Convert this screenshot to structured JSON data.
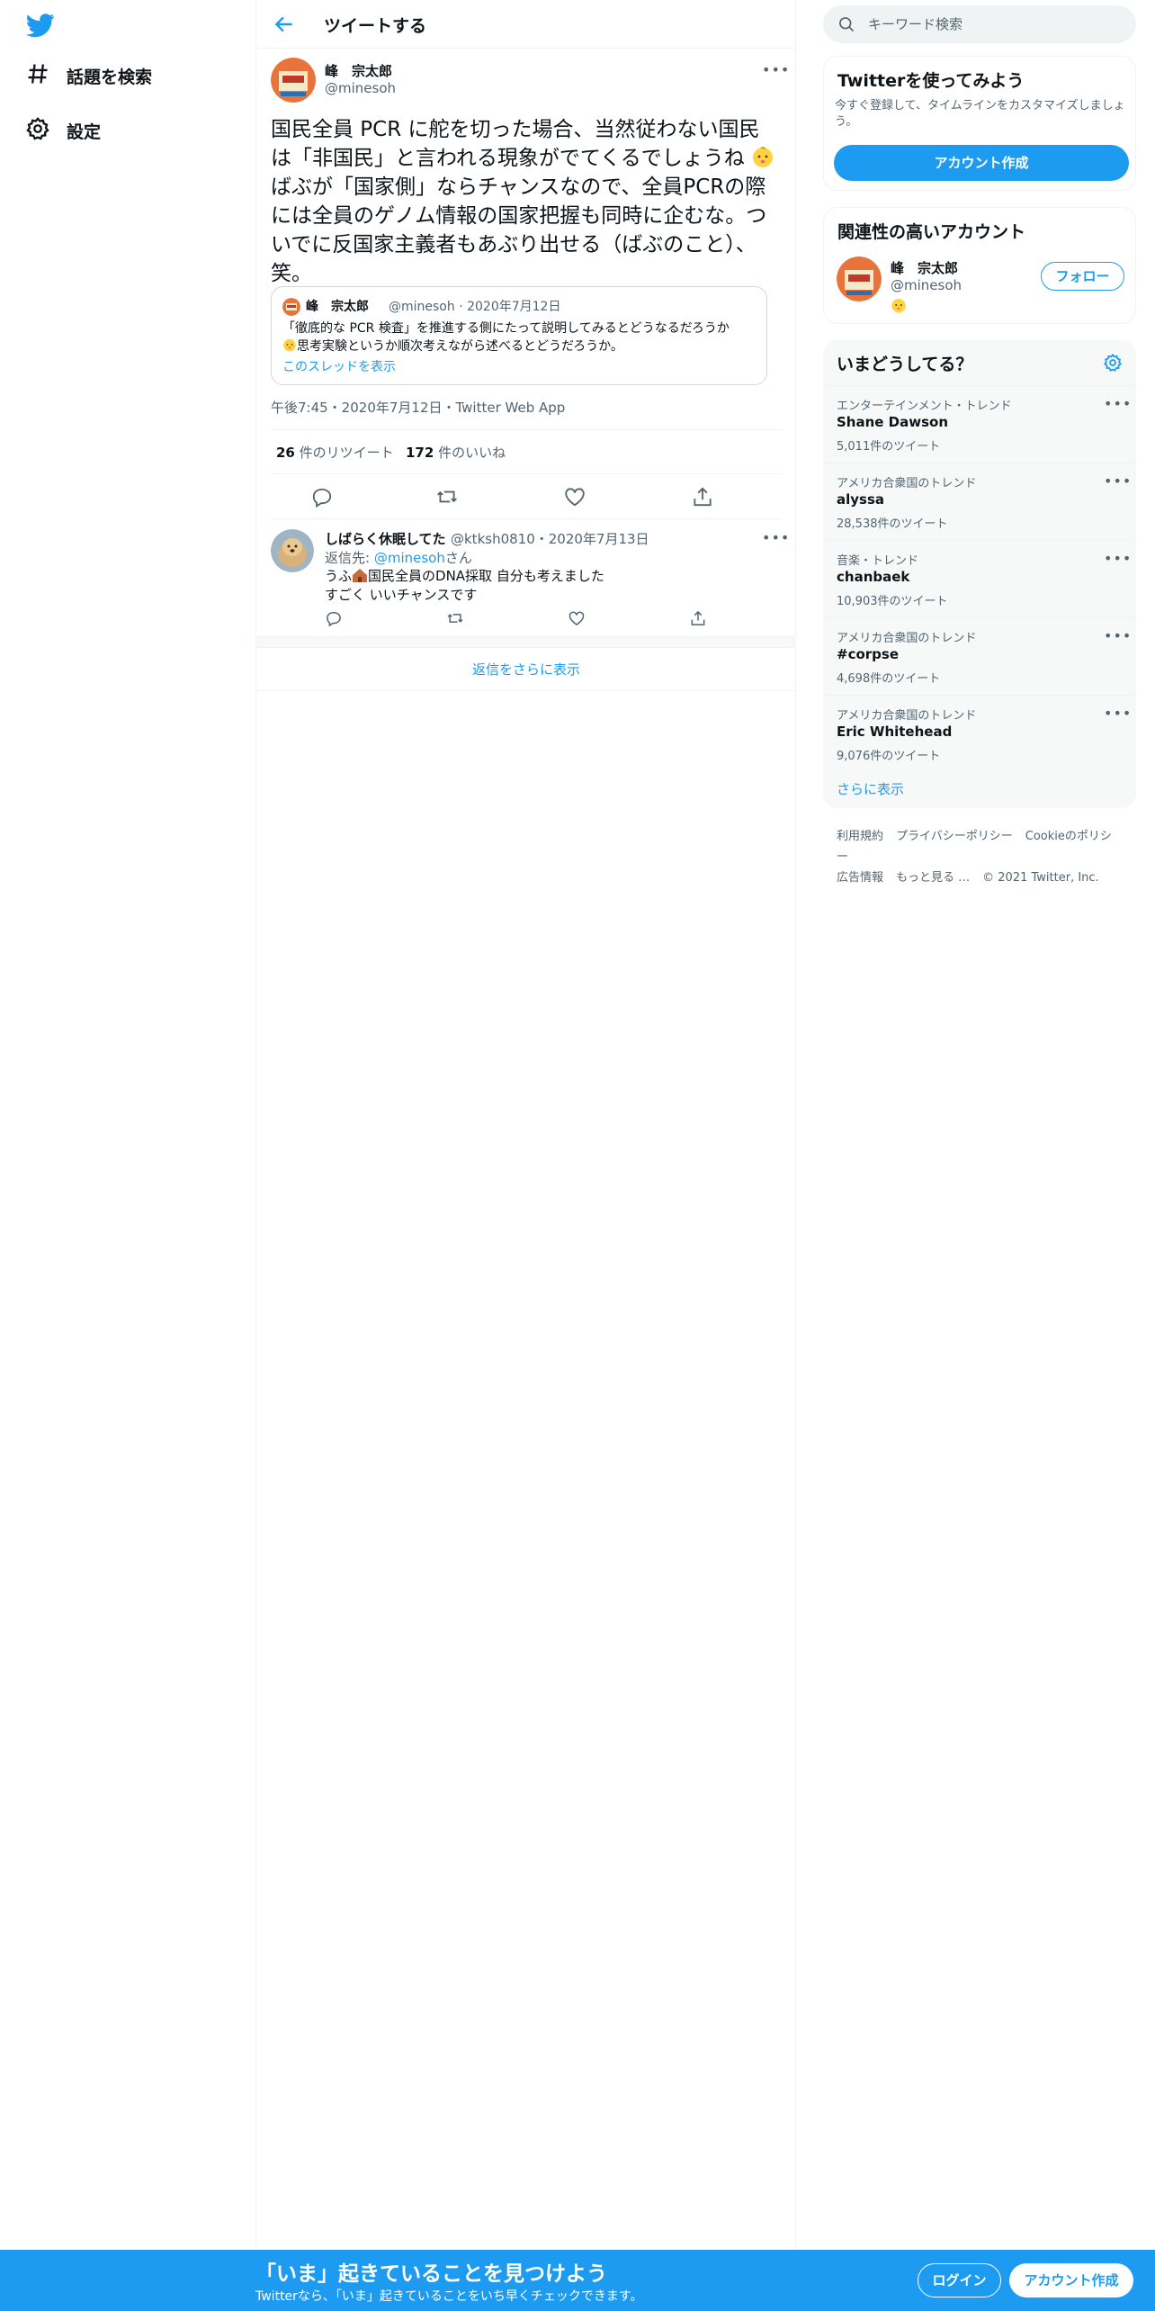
{
  "colors": {
    "accent": "#1d9bf0",
    "text": "#0f1419",
    "secondary": "#536471",
    "border": "#eff3f4"
  },
  "nav": {
    "items": [
      {
        "label": "話題を検索",
        "icon": "hashtag-icon"
      },
      {
        "label": "設定",
        "icon": "gear-icon"
      }
    ]
  },
  "header": {
    "title": "ツイートする"
  },
  "tweet": {
    "author_name": "峰　宗太郎",
    "author_handle": "@minesoh",
    "text_part1": "国民全員 PCR に舵を切った場合、当然従わない国民は「非国民」と言われる現象がでてくるでしょうね",
    "text_part2": "ばぶが「国家側」ならチャンスなので、全員PCRの際には全員のゲノム情報の国家把握も同時に企むな。ついでに反国家主義者もあぶり出せる（ばぶのこと）、笑。",
    "quote": {
      "author_name": "峰　宗太郎",
      "meta": "@minesoh · 2020年7月12日",
      "text_part1": "「徹底的な PCR 検査」を推進する側にたって説明してみるとどうなるだろうか",
      "text_part2": "思考実験というか順次考えながら述べるとどうだろうか。",
      "thread_link": "このスレッドを表示"
    },
    "meta": "午後7:45・2020年7月12日・Twitter Web App",
    "retweets": "26",
    "retweets_label": "件のリツイート",
    "likes": "172",
    "likes_label": "件のいいね"
  },
  "reply": {
    "author_name": "しばらく休眠してた",
    "meta": "@ktksh0810・2020年7月13日",
    "reply_to_prefix": "返信先: ",
    "reply_to_handle": "@minesoh",
    "reply_to_suffix": "さん",
    "text_line1_a": "うふ",
    "text_line1_b": "国民全員のDNA採取 自分も考えました",
    "text_line2": "すごく いいチャンスです"
  },
  "more_replies": "返信をさらに表示",
  "search": {
    "placeholder": "キーワード検索"
  },
  "signup_card": {
    "title": "Twitterを使ってみよう",
    "description": "今すぐ登録して、タイムラインをカスタマイズしましょう。",
    "button": "アカウント作成"
  },
  "related": {
    "title": "関連性の高いアカウント",
    "name": "峰　宗太郎",
    "handle": "@minesoh",
    "follow": "フォロー"
  },
  "trends": {
    "title": "いまどうしてる？",
    "items": [
      {
        "category": "エンターテインメント・トレンド",
        "name": "Shane Dawson",
        "count": "5,011件のツイート"
      },
      {
        "category": "アメリカ合衆国のトレンド",
        "name": "alyssa",
        "count": "28,538件のツイート"
      },
      {
        "category": "音楽・トレンド",
        "name": "chanbaek",
        "count": "10,903件のツイート"
      },
      {
        "category": "アメリカ合衆国のトレンド",
        "name": "#corpse",
        "count": "4,698件のツイート"
      },
      {
        "category": "アメリカ合衆国のトレンド",
        "name": "Eric Whitehead",
        "count": "9,076件のツイート"
      }
    ],
    "show_more": "さらに表示"
  },
  "footer": {
    "terms": "利用規約",
    "privacy": "プライバシーポリシー",
    "cookie": "Cookieのポリシー",
    "ads": "広告情報",
    "more": "もっと見る …",
    "copyright": "© 2021 Twitter, Inc."
  },
  "bottom_bar": {
    "title": "「いま」起きていることを見つけよう",
    "subtitle": "Twitterなら、「いま」起きていることをいち早くチェックできます。",
    "login": "ログイン",
    "signup": "アカウント作成"
  }
}
